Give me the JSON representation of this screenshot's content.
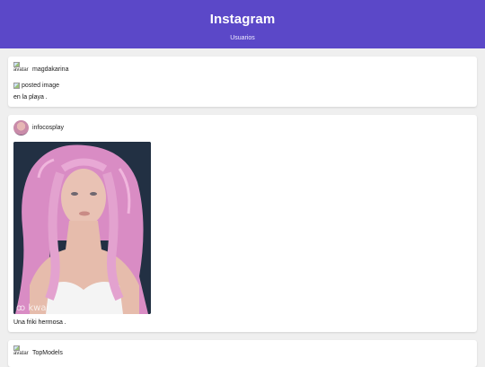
{
  "header": {
    "title": "Instagram",
    "nav_link": "Usuarios"
  },
  "colors": {
    "header_bg": "#5b48c8",
    "page_bg": "#efefef"
  },
  "posts": [
    {
      "username": "magdakarina",
      "avatar_alt": "avatar",
      "avatar_state": "broken",
      "image_alt": "posted image",
      "image_state": "broken",
      "caption": "en la playa ."
    },
    {
      "username": "infocosplay",
      "avatar_state": "loaded",
      "image_state": "loaded",
      "image_subject": "woman-with-pink-hair-photo",
      "image_watermark": "ꝏ kwai",
      "caption": "Una friki hermosa ."
    },
    {
      "username": "TopModels",
      "avatar_alt": "avatar",
      "avatar_state": "broken"
    }
  ]
}
